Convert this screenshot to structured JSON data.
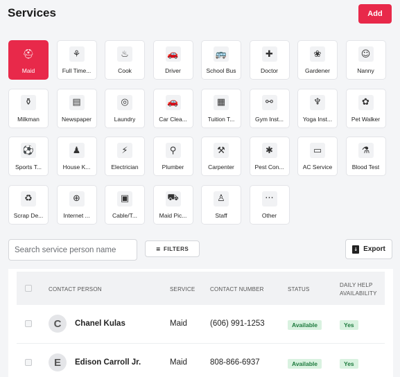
{
  "header": {
    "title": "Services",
    "add_label": "Add"
  },
  "services": [
    {
      "label": "Maid",
      "icon": "cloche-icon",
      "glyph": "⛑",
      "active": true
    },
    {
      "label": "Full Time...",
      "icon": "person-broom-icon",
      "glyph": "⚘"
    },
    {
      "label": "Cook",
      "icon": "chef-hat-icon",
      "glyph": "♨"
    },
    {
      "label": "Driver",
      "icon": "car-icon",
      "glyph": "🚗"
    },
    {
      "label": "School Bus",
      "icon": "bus-icon",
      "glyph": "🚌"
    },
    {
      "label": "Doctor",
      "icon": "medical-bag-icon",
      "glyph": "✚"
    },
    {
      "label": "Gardener",
      "icon": "plant-icon",
      "glyph": "❀"
    },
    {
      "label": "Nanny",
      "icon": "stroller-icon",
      "glyph": "☺"
    },
    {
      "label": "Milkman",
      "icon": "milk-bottle-icon",
      "glyph": "⚱"
    },
    {
      "label": "Newspaper",
      "icon": "newspaper-icon",
      "glyph": "▤"
    },
    {
      "label": "Laundry",
      "icon": "washing-machine-icon",
      "glyph": "◎"
    },
    {
      "label": "Car Clea...",
      "icon": "car-wash-icon",
      "glyph": "🚗"
    },
    {
      "label": "Tuition T...",
      "icon": "book-icon",
      "glyph": "▦"
    },
    {
      "label": "Gym Inst...",
      "icon": "dumbbell-icon",
      "glyph": "⚯"
    },
    {
      "label": "Yoga Inst...",
      "icon": "yoga-icon",
      "glyph": "♆"
    },
    {
      "label": "Pet Walker",
      "icon": "paw-icon",
      "glyph": "✿"
    },
    {
      "label": "Sports T...",
      "icon": "ball-icon",
      "glyph": "⚽"
    },
    {
      "label": "House K...",
      "icon": "broom-icon",
      "glyph": "♟"
    },
    {
      "label": "Electrician",
      "icon": "plug-icon",
      "glyph": "⚡"
    },
    {
      "label": "Plumber",
      "icon": "plunger-icon",
      "glyph": "⚲"
    },
    {
      "label": "Carpenter",
      "icon": "hammer-icon",
      "glyph": "⚒"
    },
    {
      "label": "Pest Con...",
      "icon": "bug-icon",
      "glyph": "✱"
    },
    {
      "label": "AC Service",
      "icon": "air-conditioner-icon",
      "glyph": "▭"
    },
    {
      "label": "Blood Test",
      "icon": "test-tube-icon",
      "glyph": "⚗"
    },
    {
      "label": "Scrap De...",
      "icon": "trash-icon",
      "glyph": "♻"
    },
    {
      "label": "Internet ...",
      "icon": "globe-icon",
      "glyph": "⊕"
    },
    {
      "label": "Cable/T...",
      "icon": "tv-icon",
      "glyph": "▣"
    },
    {
      "label": "Maid Pic...",
      "icon": "scooter-icon",
      "glyph": "⛟"
    },
    {
      "label": "Staff",
      "icon": "user-icon",
      "glyph": "♙"
    },
    {
      "label": "Other",
      "icon": "more-icon",
      "glyph": "···"
    }
  ],
  "search": {
    "placeholder": "Search service person name"
  },
  "filters_label": "FILTERS",
  "export_label": "Export",
  "table": {
    "columns": {
      "contact_person": "CONTACT PERSON",
      "service": "SERVICE",
      "contact_number": "CONTACT NUMBER",
      "status": "STATUS",
      "daily_help_1": "DAILY HELP",
      "daily_help_2": "AVAILABILITY"
    },
    "rows": [
      {
        "initial": "C",
        "name": "Chanel Kulas",
        "service": "Maid",
        "phone": "(606) 991-1253",
        "status": "Available",
        "availability": "Yes"
      },
      {
        "initial": "E",
        "name": "Edison Carroll Jr.",
        "service": "Maid",
        "phone": "808-866-6937",
        "status": "Available",
        "availability": "Yes"
      }
    ]
  },
  "colors": {
    "accent": "#e8294a",
    "badge_bg": "#d9f2e0",
    "badge_text": "#1d7a3d"
  }
}
